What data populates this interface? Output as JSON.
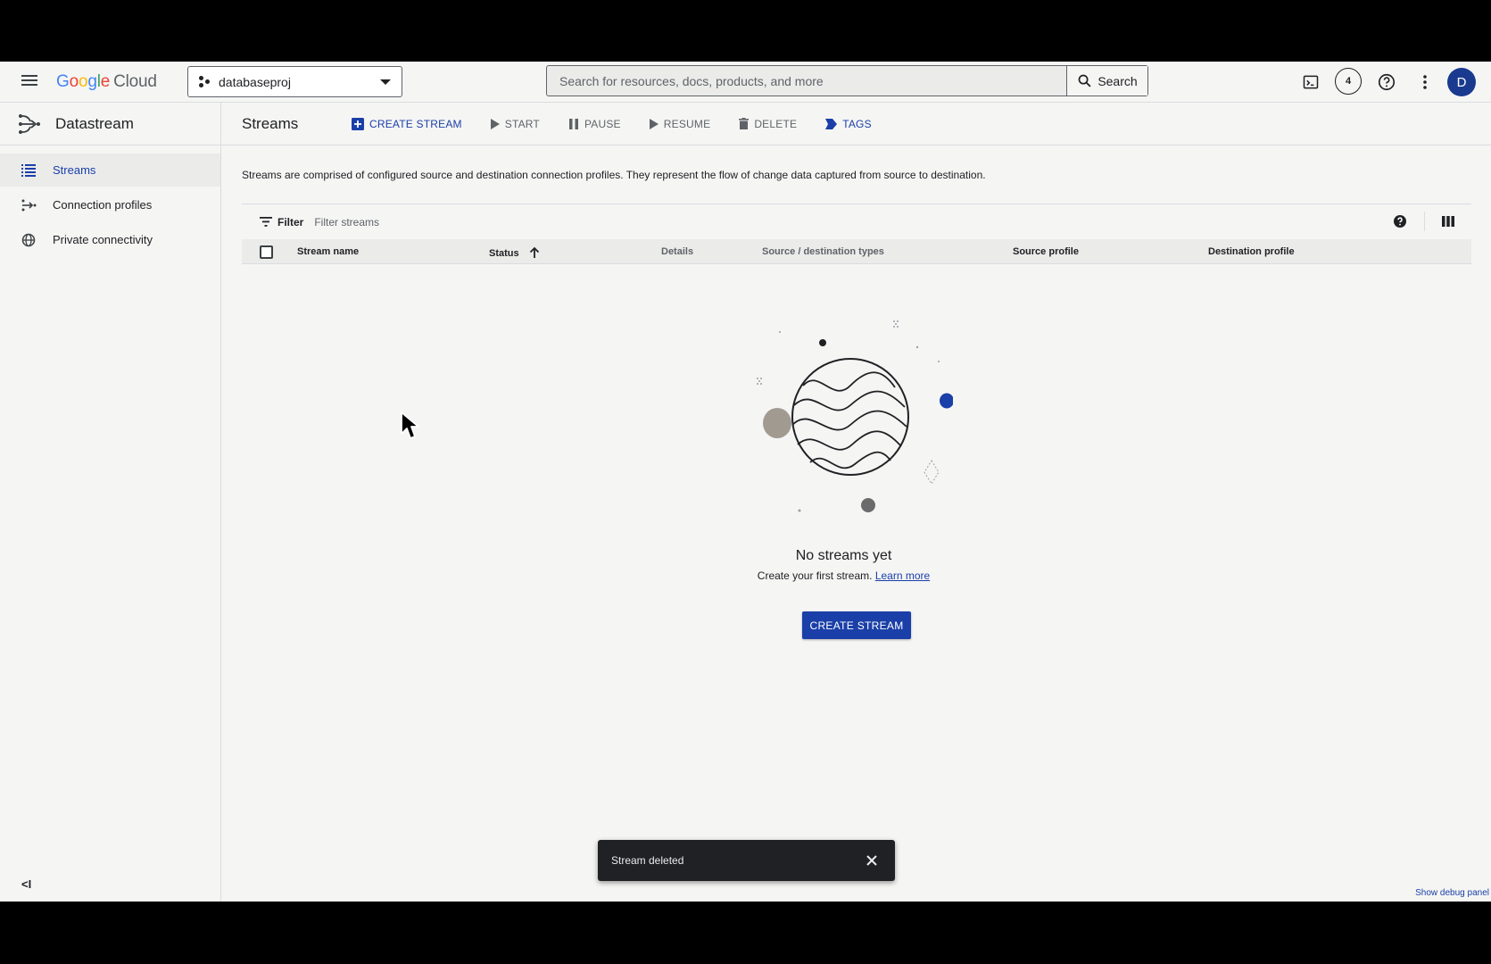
{
  "topbar": {
    "logo_google": [
      "G",
      "o",
      "o",
      "g",
      "l",
      "e"
    ],
    "logo_cloud": "Cloud",
    "project": "databaseproj",
    "search_placeholder": "Search for resources, docs, products, and more",
    "search_button": "Search",
    "notification_count": "4",
    "avatar_letter": "D"
  },
  "sidebar": {
    "product": "Datastream",
    "items": [
      {
        "label": "Streams",
        "icon": "list-icon",
        "active": true
      },
      {
        "label": "Connection profiles",
        "icon": "connection-icon",
        "active": false
      },
      {
        "label": "Private connectivity",
        "icon": "globe-icon",
        "active": false
      }
    ],
    "collapse_label": "<I"
  },
  "main": {
    "title": "Streams",
    "actions": [
      {
        "label": "CREATE STREAM",
        "icon": "add-box-icon",
        "color": "blue"
      },
      {
        "label": "START",
        "icon": "play-icon",
        "color": "gray"
      },
      {
        "label": "PAUSE",
        "icon": "pause-icon",
        "color": "gray"
      },
      {
        "label": "RESUME",
        "icon": "play-icon",
        "color": "gray"
      },
      {
        "label": "DELETE",
        "icon": "trash-icon",
        "color": "gray"
      },
      {
        "label": "TAGS",
        "icon": "tag-icon",
        "color": "blue"
      }
    ],
    "description": "Streams are comprised of configured source and destination connection profiles. They represent the flow of change data captured from source to destination.",
    "filter_label": "Filter",
    "filter_placeholder": "Filter streams",
    "columns": [
      "Stream name",
      "Status",
      "Details",
      "Source / destination types",
      "Source profile",
      "Destination profile"
    ],
    "empty_title": "No streams yet",
    "empty_sub": "Create your first stream.",
    "learn_more": "Learn more",
    "empty_button": "CREATE STREAM"
  },
  "snackbar": {
    "message": "Stream deleted"
  },
  "debug_link": "Show debug panel",
  "colors": {
    "accent": "#1a3fa8",
    "background": "#f5f5f4",
    "snackbar": "#202124"
  }
}
